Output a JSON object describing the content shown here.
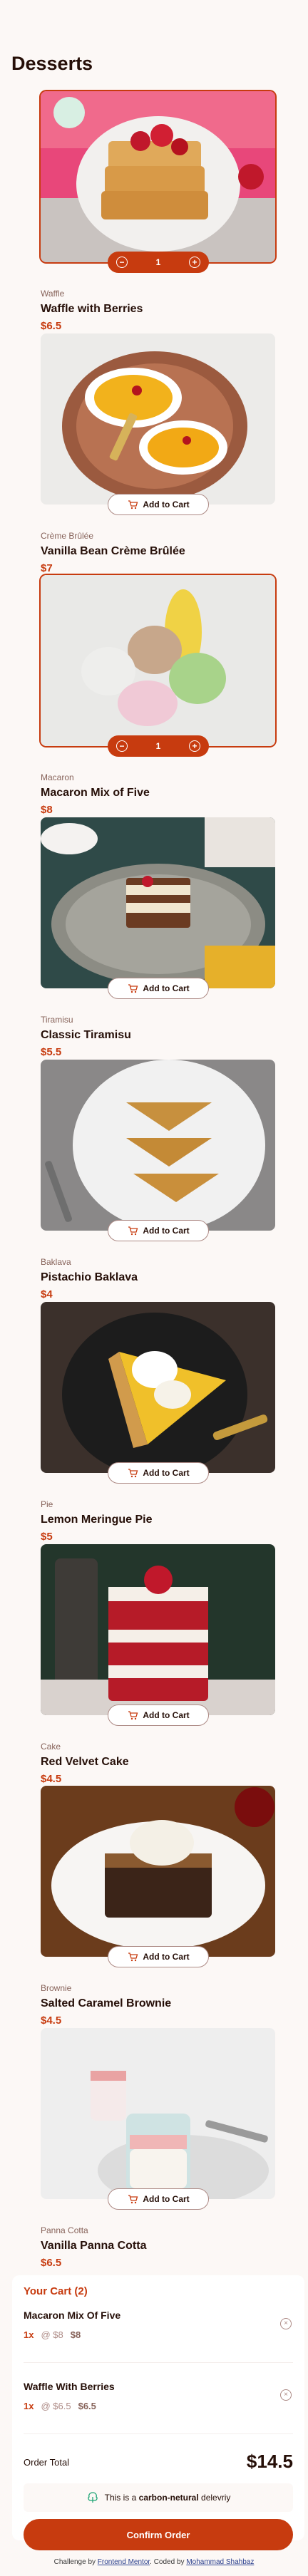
{
  "page": {
    "title": "Desserts"
  },
  "buttons": {
    "add_to_cart": "Add to Cart",
    "decrement_symbol": "−",
    "increment_symbol": "+"
  },
  "products": [
    {
      "category": "Waffle",
      "name": "Waffle with Berries",
      "price": "$6.5",
      "in_cart": true,
      "quantity": "1",
      "image_icon": "waffle-image"
    },
    {
      "category": "Crème Brûlée",
      "name": "Vanilla Bean Crème Brûlée",
      "price": "$7",
      "in_cart": false,
      "image_icon": "creme-brulee-image"
    },
    {
      "category": "Macaron",
      "name": "Macaron Mix of Five",
      "price": "$8",
      "in_cart": true,
      "quantity": "1",
      "image_icon": "macaron-image"
    },
    {
      "category": "Tiramisu",
      "name": "Classic Tiramisu",
      "price": "$5.5",
      "in_cart": false,
      "image_icon": "tiramisu-image"
    },
    {
      "category": "Baklava",
      "name": "Pistachio Baklava",
      "price": "$4",
      "in_cart": false,
      "image_icon": "baklava-image"
    },
    {
      "category": "Pie",
      "name": "Lemon Meringue Pie",
      "price": "$5",
      "in_cart": false,
      "image_icon": "pie-image"
    },
    {
      "category": "Cake",
      "name": "Red Velvet Cake",
      "price": "$4.5",
      "in_cart": false,
      "image_icon": "cake-image"
    },
    {
      "category": "Brownie",
      "name": "Salted Caramel Brownie",
      "price": "$4.5",
      "in_cart": false,
      "image_icon": "brownie-image"
    },
    {
      "category": "Panna Cotta",
      "name": "Vanilla Panna Cotta",
      "price": "$6.5",
      "in_cart": false,
      "image_icon": "panna-cotta-image"
    }
  ],
  "cart": {
    "title": "Your Cart (2)",
    "items": [
      {
        "name": "Macaron Mix Of Five",
        "qty": "1x",
        "unit_price": "@ $8",
        "total": "$8"
      },
      {
        "name": "Waffle With Berries",
        "qty": "1x",
        "unit_price": "@ $6.5",
        "total": "$6.5"
      }
    ],
    "remove_symbol": "×",
    "order_total_label": "Order Total",
    "order_total": "$14.5",
    "carbon_prefix": "This is a",
    "carbon_bold": "carbon-netural",
    "carbon_suffix": "delevriy",
    "confirm_label": "Confirm Order"
  },
  "footer": {
    "challenge_prefix": "Challenge by",
    "challenge_link": "Frontend Mentor",
    "coded_prefix": ". Coded by",
    "coded_link": "Mohammad Shahbaz"
  },
  "colors": {
    "accent": "#c73b0f",
    "rose_900": "#260f08",
    "rose_500": "#87635a",
    "rose_50": "#fcf8f6",
    "green": "#1ea575"
  }
}
